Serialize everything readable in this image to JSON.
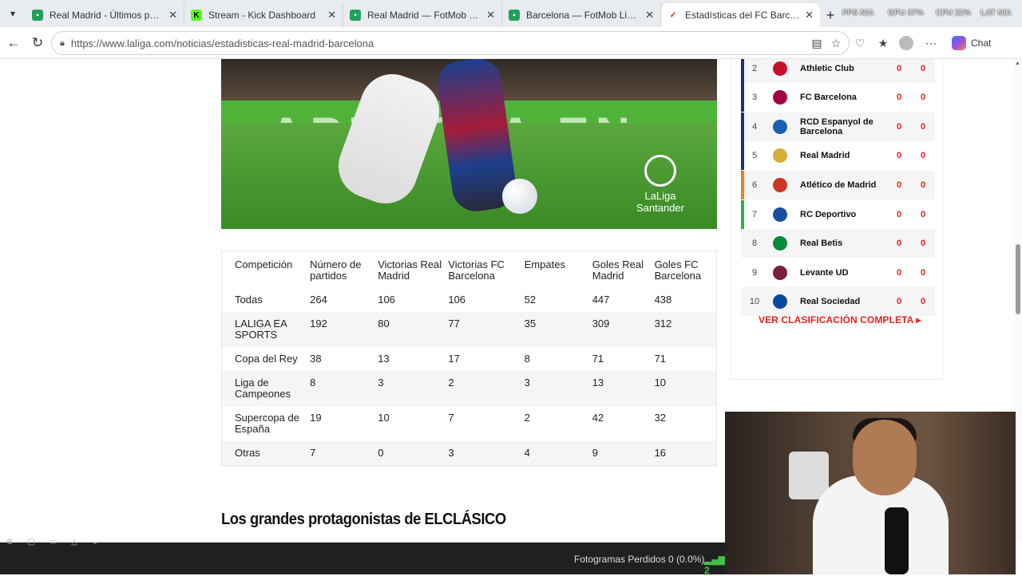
{
  "browser": {
    "tabs": [
      {
        "title": "Real Madrid - Últimos partidos, pu",
        "active": false,
        "favicon": "fotmob-icon"
      },
      {
        "title": "Stream - Kick Dashboard",
        "active": false,
        "favicon": "kick-icon"
      },
      {
        "title": "Real Madrid — FotMob Lineup Bu",
        "active": false,
        "favicon": "fotmob-icon"
      },
      {
        "title": "Barcelona — FotMob Lineup Build",
        "active": false,
        "favicon": "fotmob-icon"
      },
      {
        "title": "Estadísticas del FC Barcelona contr",
        "active": true,
        "favicon": "laliga-icon"
      }
    ],
    "hud": {
      "fps": "FPS N/A",
      "gpu": "GPU 37%",
      "cpu": "CPU 22%",
      "lat": "LAT N/A"
    },
    "url": "https://www.laliga.com/noticias/estadisticas-real-madrid-barcelona",
    "chat_label": "Chat"
  },
  "stats_table": {
    "headers": [
      "Competición",
      "Número de partidos",
      "Victorias Real Madrid",
      "Victorias FC Barcelona",
      "Empates",
      "Goles Real Madrid",
      "Goles FC Barcelona"
    ],
    "rows": [
      [
        "Todas",
        "264",
        "106",
        "106",
        "52",
        "447",
        "438"
      ],
      [
        "LALIGA EA SPORTS",
        "192",
        "80",
        "77",
        "35",
        "309",
        "312"
      ],
      [
        "Copa del Rey",
        "38",
        "13",
        "17",
        "8",
        "71",
        "71"
      ],
      [
        "Liga de Campeones",
        "8",
        "3",
        "2",
        "3",
        "13",
        "10"
      ],
      [
        "Supercopa de España",
        "19",
        "10",
        "7",
        "2",
        "42",
        "32"
      ],
      [
        "Otras",
        "7",
        "0",
        "3",
        "4",
        "9",
        "16"
      ]
    ]
  },
  "section_heading": "Los grandes protagonistas de ELCLÁSICO",
  "hero_image": {
    "logo_text_1": "LaLiga",
    "logo_text_2": "Santander"
  },
  "standings": {
    "rows": [
      {
        "pos": "2",
        "team": "Athletic Club",
        "v1": "0",
        "v2": "0",
        "bar": "#1f2f86",
        "crest": "#c8102e"
      },
      {
        "pos": "3",
        "team": "FC Barcelona",
        "v1": "0",
        "v2": "0",
        "bar": "#1f2f86",
        "crest": "#a50044"
      },
      {
        "pos": "4",
        "team": "RCD Espanyol de Barcelona",
        "v1": "0",
        "v2": "0",
        "bar": "#1f2f86",
        "crest": "#1a5fb4"
      },
      {
        "pos": "5",
        "team": "Real Madrid",
        "v1": "0",
        "v2": "0",
        "bar": "#1f2f86",
        "crest": "#d4af37"
      },
      {
        "pos": "6",
        "team": "Atlético de Madrid",
        "v1": "0",
        "v2": "0",
        "bar": "#f07f1a",
        "crest": "#cb3524"
      },
      {
        "pos": "7",
        "team": "RC Deportivo",
        "v1": "0",
        "v2": "0",
        "bar": "#2bb14c",
        "crest": "#1a4ea1"
      },
      {
        "pos": "8",
        "team": "Real Betis",
        "v1": "0",
        "v2": "0",
        "bar": "",
        "crest": "#0b8a3a"
      },
      {
        "pos": "9",
        "team": "Levante UD",
        "v1": "0",
        "v2": "0",
        "bar": "",
        "crest": "#7a1f3d"
      },
      {
        "pos": "10",
        "team": "Real Sociedad",
        "v1": "0",
        "v2": "0",
        "bar": "",
        "crest": "#0a4a9e"
      }
    ],
    "full_link": "VER CLASIFICACIÓN COMPLETA ▸"
  },
  "obs": {
    "dropped_frames": "Fotogramas Perdidos 0 (0.0%)",
    "signal": "2"
  },
  "colors": {
    "accent": "#e2231a",
    "champions": "#1f2f86",
    "europa": "#f07f1a",
    "conference": "#2bb14c"
  }
}
